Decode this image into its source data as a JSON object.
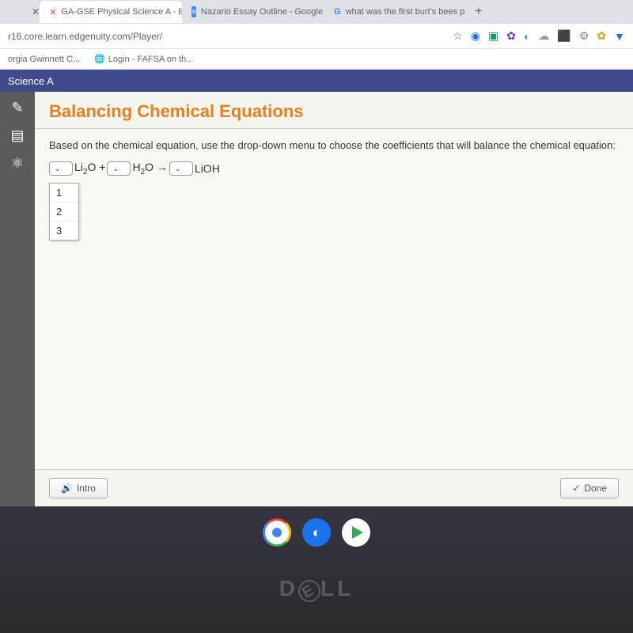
{
  "tabs": [
    {
      "label": "GA-GSE Physical Science A - Ed",
      "icon": "✕"
    },
    {
      "label": "Nazario Essay Outline - Google",
      "icon": "≡"
    },
    {
      "label": "what was the first burt's bees p",
      "icon": "G"
    }
  ],
  "url": "r16.core.learn.edgenuity.com/Player/",
  "bookmarks": [
    {
      "label": "orgia Gwinnett C..."
    },
    {
      "label": "Login - FAFSA on th..."
    }
  ],
  "course_header": "Science A",
  "lesson": {
    "title": "Balancing Chemical Equations",
    "instruction": "Based on the chemical equation, use the drop-down menu to choose the coefficients that will balance the chemical equation:",
    "equation": {
      "term1": "Li₂O +",
      "term2": "H₂O →",
      "term3": "LiOH"
    },
    "dropdown_options": [
      "1",
      "2",
      "3"
    ]
  },
  "buttons": {
    "intro": "Intro",
    "done": "Done"
  },
  "dell": "D LL",
  "icons": {
    "star": "☆",
    "chevron": "⌄",
    "speaker": "🔊",
    "check": "✓",
    "pencil": "✎",
    "notes": "▤",
    "atom": "⚛"
  }
}
